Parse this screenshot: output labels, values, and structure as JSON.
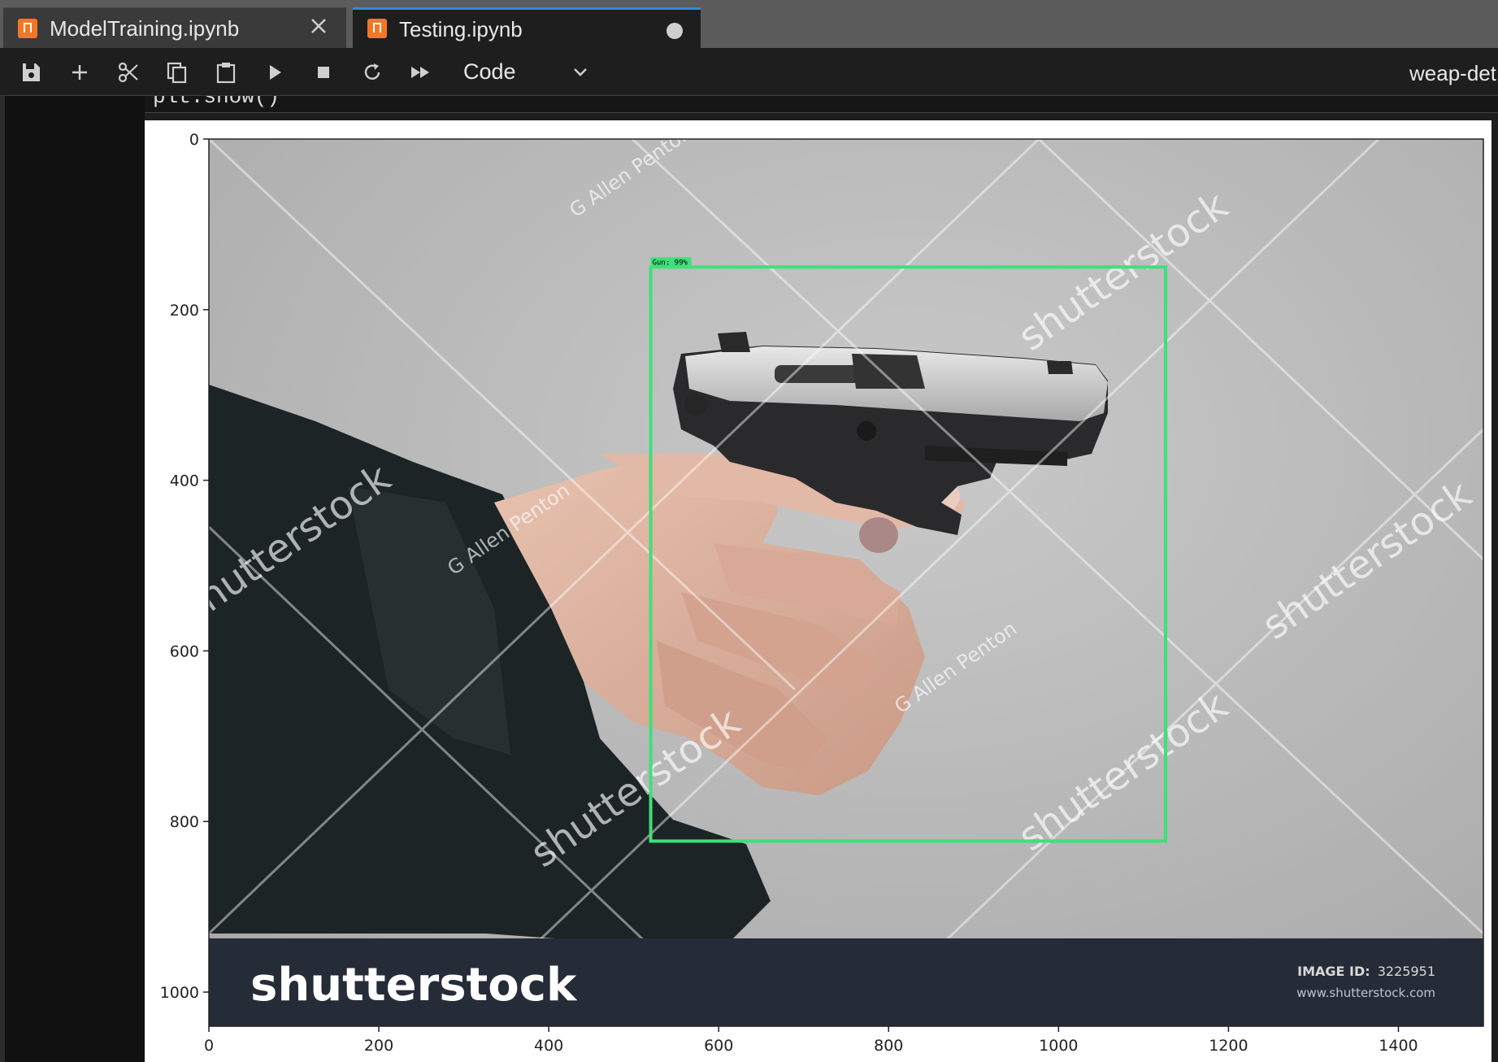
{
  "tabs": [
    {
      "label": "ModelTraining.ipynb",
      "active": false,
      "icon": "notebook-icon",
      "action": "close"
    },
    {
      "label": "Testing.ipynb",
      "active": true,
      "icon": "notebook-icon",
      "action": "unsaved-dot"
    }
  ],
  "toolbar": {
    "buttons": [
      "save-icon",
      "add-icon",
      "cut-icon",
      "copy-icon",
      "paste-icon",
      "run-icon",
      "stop-icon",
      "restart-icon",
      "fast-forward-icon"
    ],
    "cell_type": "Code",
    "kernel": "weap-det"
  },
  "cell": {
    "code_fragment": "plt.show()"
  },
  "output_figure": {
    "xticks": [
      "0",
      "200",
      "400",
      "600",
      "800",
      "1000",
      "1200",
      "1400"
    ],
    "yticks": [
      "0",
      "200",
      "400",
      "600",
      "800",
      "1000"
    ],
    "xlim": [
      0,
      1500
    ],
    "ylim": [
      1040,
      0
    ],
    "detection": {
      "label": "Gun: 99%",
      "box_color": "#3ee07a",
      "x_min": 520,
      "y_min": 150,
      "x_max": 1126,
      "y_max": 823
    },
    "photo_banner": {
      "brand": "shutterstock",
      "image_id_label": "IMAGE ID:",
      "image_id": "3225951",
      "website": "www.shutterstock.com"
    },
    "watermarks": [
      "shutterstock",
      "G Allen Penton"
    ]
  },
  "colors": {
    "tab_accent": "#2f8ce0",
    "notebook_icon": "#f37726",
    "detection_box": "#3ee07a"
  }
}
